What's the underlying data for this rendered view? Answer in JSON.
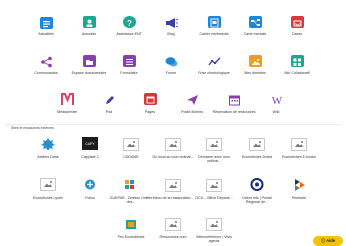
{
  "apps": [
    {
      "label": "Actualités",
      "icon": "news-icon",
      "color": "#1e88d6"
    },
    {
      "label": "Annuaire",
      "icon": "contacts-icon",
      "color": "#1aa891"
    },
    {
      "label": "Assistance ENT",
      "icon": "help-circle-icon",
      "color": "#1aa891"
    },
    {
      "label": "Blog",
      "icon": "megaphone-icon",
      "color": "#3a3fa8"
    },
    {
      "label": "Cahier multimédia",
      "icon": "notebook-icon",
      "color": "#1e88d6"
    },
    {
      "label": "Carte mentale",
      "icon": "mindmap-icon",
      "color": "#1e88d6"
    },
    {
      "label": "Casier",
      "icon": "inbox-icon",
      "color": "#d43a3a"
    },
    {
      "label": "Communautés",
      "icon": "share-icon",
      "color": "#8a3fb0"
    },
    {
      "label": "Espace documentaire",
      "icon": "folder-icon",
      "color": "#8a3fb0"
    },
    {
      "label": "Formulaire",
      "icon": "form-icon",
      "color": "#8a3fb0"
    },
    {
      "label": "Forum",
      "icon": "chat-icon",
      "color": "#1e88d6"
    },
    {
      "label": "Frise chronologique",
      "icon": "timeline-icon",
      "color": "#3a3fa8"
    },
    {
      "label": "Mes données",
      "icon": "image-icon",
      "color": "#e8a020"
    },
    {
      "label": "Mur Collaboratif",
      "icon": "board-icon",
      "color": "#1aa891"
    },
    {
      "label": "Médiacentre",
      "icon": "mediacentre-icon",
      "color": "#e04060"
    },
    {
      "label": "Pad",
      "icon": "pencil-icon",
      "color": "#3a3fa8"
    },
    {
      "label": "Pages",
      "icon": "pages-icon",
      "color": "#d43a3a"
    },
    {
      "label": "Poste-fichiers",
      "icon": "send-icon",
      "color": "#8a3fb0"
    },
    {
      "label": "Réservation de ressources",
      "icon": "calendar-icon",
      "color": "#8a3fb0"
    },
    {
      "label": "Wiki",
      "icon": "wikipedia-icon",
      "color": "#8a3fb0"
    }
  ],
  "section_label": "Sites et ressources externes",
  "externals": [
    {
      "label": "Ateliers Dane",
      "icon": "ateliers-icon"
    },
    {
      "label": "Capytale 2",
      "icon": "capytale-icon"
    },
    {
      "label": "CDDAME",
      "icon": "image-placeholder-icon"
    },
    {
      "label": "Du local au mon ordinat...",
      "icon": "image-placeholder-icon"
    },
    {
      "label": "Démarrer avec mon ordinat...",
      "icon": "image-placeholder-icon"
    },
    {
      "label": "Econofiches 2ndes",
      "icon": "image-placeholder-icon"
    },
    {
      "label": "Econofiches E-books",
      "icon": "image-placeholder-icon"
    },
    {
      "label": "Econofiches Lycée",
      "icon": "image-placeholder-icon"
    },
    {
      "label": "Folios",
      "icon": "folios-icon"
    },
    {
      "label": "GUEPAR - Gestion Unifiée des...",
      "icon": "guepar-icon"
    },
    {
      "label": "Menu de la restauration...",
      "icon": "image-placeholder-icon"
    },
    {
      "label": "OCIL - Office Départe...",
      "icon": "image-placeholder-icon"
    },
    {
      "label": "Orient info | Portail Régional de...",
      "icon": "orient-icon"
    },
    {
      "label": "Peertube",
      "icon": "peertube-icon"
    },
    {
      "label": "Prix Econofiches",
      "icon": "prix-icon"
    },
    {
      "label": "Ressources num",
      "icon": "image-placeholder-icon"
    },
    {
      "label": "Webconférence | Visio agents",
      "icon": "image-placeholder-icon"
    }
  ],
  "help_button": "Aide"
}
